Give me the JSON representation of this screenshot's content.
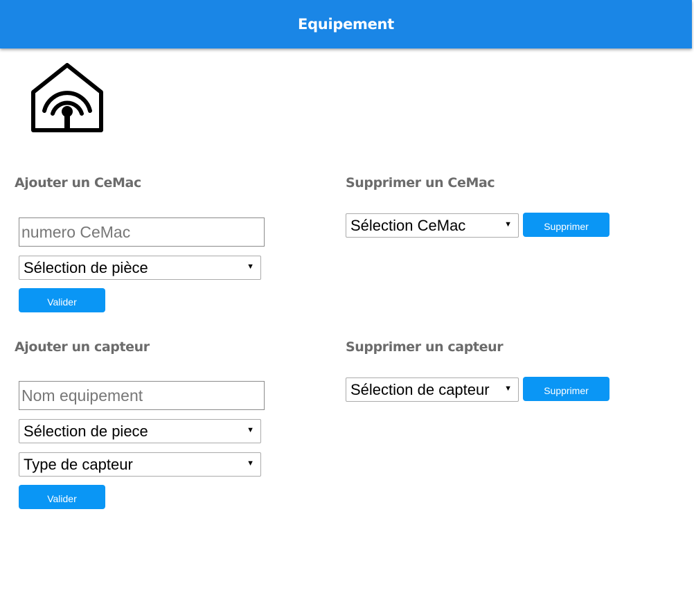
{
  "header": {
    "title": "Equipement"
  },
  "logo": {
    "icon": "smart-home-wifi-icon"
  },
  "add_cemac": {
    "title": "Ajouter un CeMac",
    "number_placeholder": "numero CeMac",
    "room_select": "Sélection de pièce",
    "submit_label": "Valider"
  },
  "delete_cemac": {
    "title": "Supprimer un CeMac",
    "cemac_select": "Sélection CeMac",
    "submit_label": "Supprimer"
  },
  "add_sensor": {
    "title": "Ajouter un capteur",
    "name_placeholder": "Nom equipement",
    "room_select": "Sélection de piece",
    "type_select": "Type de capteur",
    "submit_label": "Valider"
  },
  "delete_sensor": {
    "title": "Supprimer un capteur",
    "sensor_select": "Sélection de capteur",
    "submit_label": "Supprimer"
  },
  "colors": {
    "header": "#1a86e6",
    "button": "#0a96f5",
    "section_title": "#6b6b6b"
  }
}
